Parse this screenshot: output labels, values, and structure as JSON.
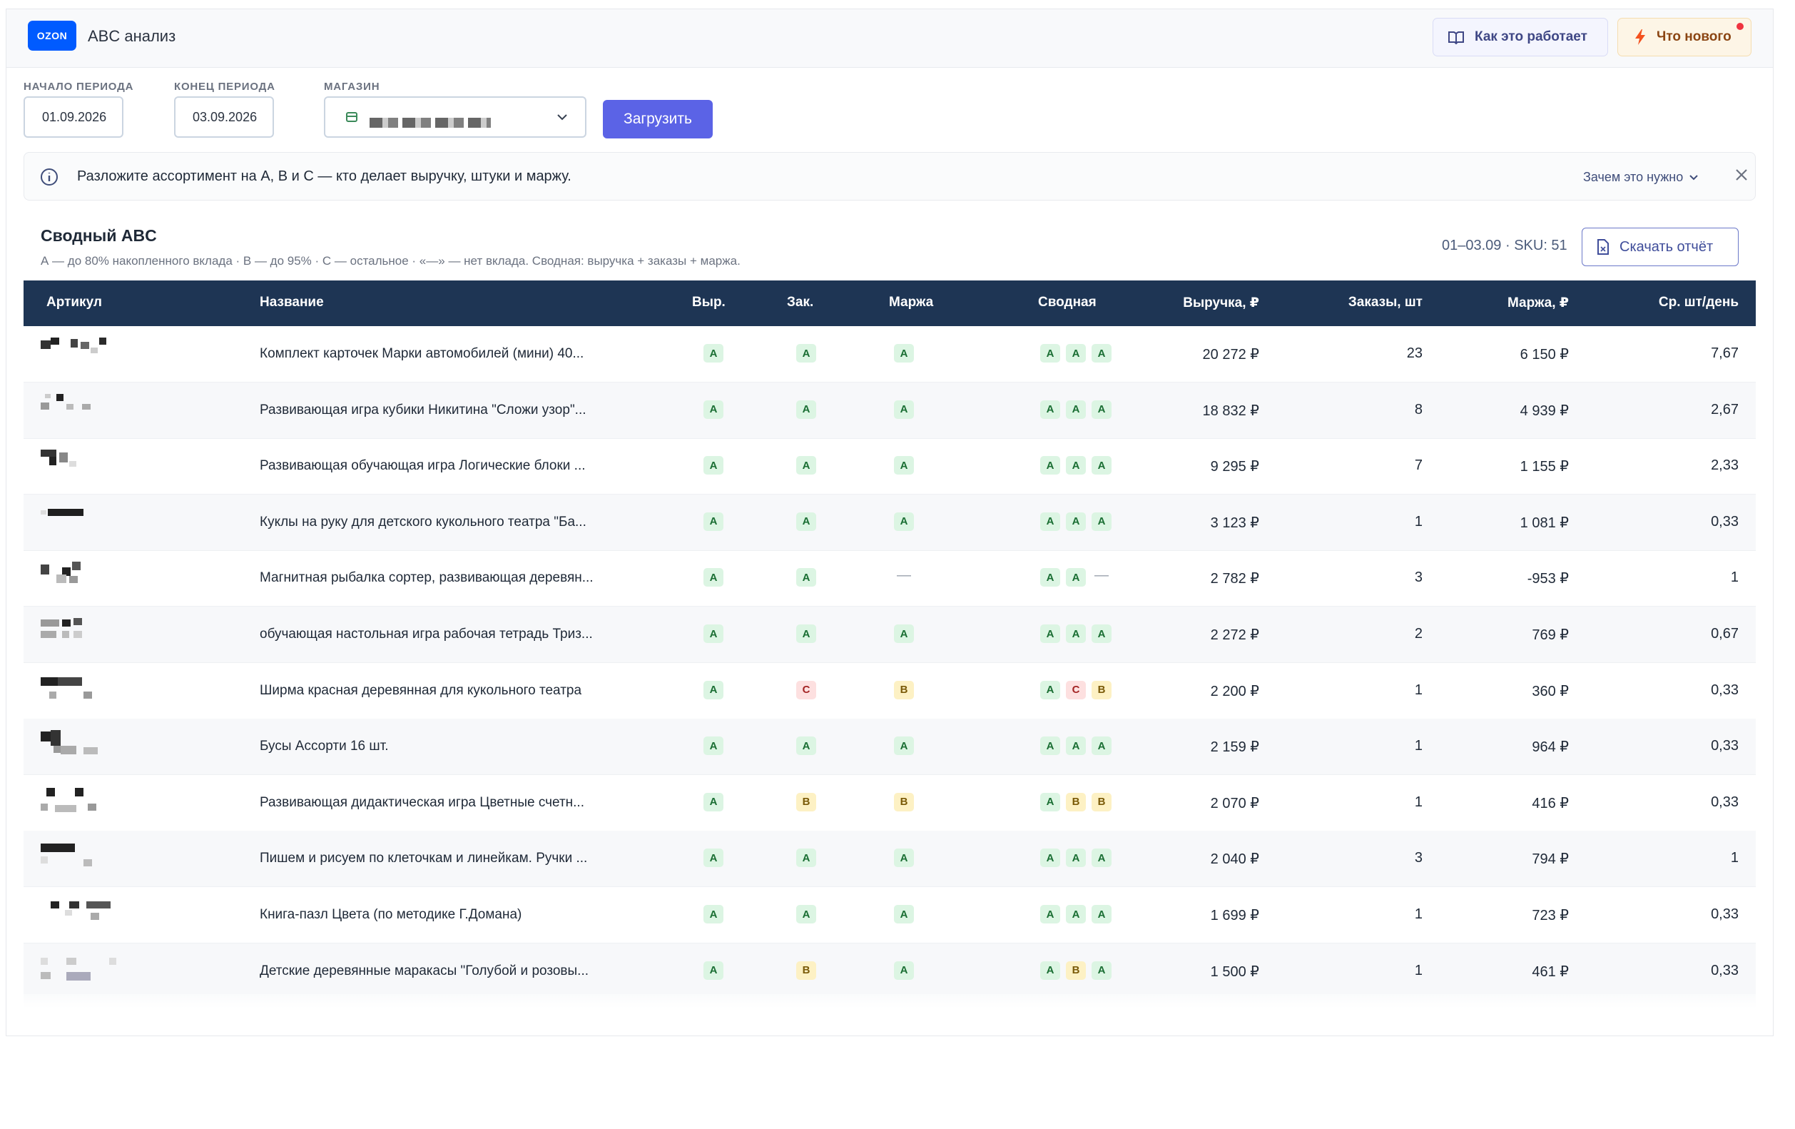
{
  "app": {
    "logo": "OZON",
    "title": "ABC анализ",
    "how_label": "Как это работает",
    "new_label": "Что нового"
  },
  "filters": {
    "start_label": "НАЧАЛО ПЕРИОДА",
    "start_value": "01.09.2026",
    "end_label": "КОНЕЦ ПЕРИОДА",
    "end_value": "03.09.2026",
    "store_label": "МАГАЗИН",
    "load_label": "Загрузить"
  },
  "info": {
    "text": "Разложите ассортимент на А, В и С — кто делает выручку, штуки и маржу.",
    "why_label": "Зачем это нужно"
  },
  "section": {
    "title": "Сводный ABC",
    "subtitle": "А — до 80% накопленного вклада · В — до 95% · С — остальное · «—» — нет вклада. Сводная: выручка + заказы + маржа.",
    "period": "01–03.09 · SKU: 51",
    "download_label": "Скачать отчёт"
  },
  "table": {
    "headers": {
      "article": "Артикул",
      "name": "Название",
      "rev": "Выр.",
      "ord": "Зак.",
      "margin": "Маржа",
      "summary": "Сводная",
      "revenue": "Выручка, ₽",
      "orders": "Заказы, шт",
      "margin_rub": "Маржа, ₽",
      "avg": "Ср. шт/день"
    },
    "rows": [
      {
        "name": "Комплект карточек Марки автомобилей (мини) 40...",
        "rev": "A",
        "ord": "A",
        "margin": "A",
        "summary": [
          "A",
          "A",
          "A"
        ],
        "revenue": "20 272 ₽",
        "orders": "23",
        "margin_rub": "6 150 ₽",
        "avg": "7,67"
      },
      {
        "name": "Развивающая игра кубики Никитина \"Сложи узор\"...",
        "rev": "A",
        "ord": "A",
        "margin": "A",
        "summary": [
          "A",
          "A",
          "A"
        ],
        "revenue": "18 832 ₽",
        "orders": "8",
        "margin_rub": "4 939 ₽",
        "avg": "2,67"
      },
      {
        "name": "Развивающая обучающая игра Логические блоки ...",
        "rev": "A",
        "ord": "A",
        "margin": "A",
        "summary": [
          "A",
          "A",
          "A"
        ],
        "revenue": "9 295 ₽",
        "orders": "7",
        "margin_rub": "1 155 ₽",
        "avg": "2,33"
      },
      {
        "name": "Куклы на руку для детского кукольного театра \"Ба...",
        "rev": "A",
        "ord": "A",
        "margin": "A",
        "summary": [
          "A",
          "A",
          "A"
        ],
        "revenue": "3 123 ₽",
        "orders": "1",
        "margin_rub": "1 081 ₽",
        "avg": "0,33"
      },
      {
        "name": "Магнитная рыбалка сортер, развивающая деревян...",
        "rev": "A",
        "ord": "A",
        "margin": "—",
        "summary": [
          "A",
          "A",
          "—"
        ],
        "revenue": "2 782 ₽",
        "orders": "3",
        "margin_rub": "-953 ₽",
        "avg": "1"
      },
      {
        "name": "обучающая настольная игра рабочая тетрадь Триз...",
        "rev": "A",
        "ord": "A",
        "margin": "A",
        "summary": [
          "A",
          "A",
          "A"
        ],
        "revenue": "2 272 ₽",
        "orders": "2",
        "margin_rub": "769 ₽",
        "avg": "0,67"
      },
      {
        "name": "Ширма красная деревянная для кукольного театра",
        "rev": "A",
        "ord": "C",
        "margin": "B",
        "summary": [
          "A",
          "C",
          "B"
        ],
        "revenue": "2 200 ₽",
        "orders": "1",
        "margin_rub": "360 ₽",
        "avg": "0,33"
      },
      {
        "name": "Бусы Ассорти 16 шт.",
        "rev": "A",
        "ord": "A",
        "margin": "A",
        "summary": [
          "A",
          "A",
          "A"
        ],
        "revenue": "2 159 ₽",
        "orders": "1",
        "margin_rub": "964 ₽",
        "avg": "0,33"
      },
      {
        "name": "Развивающая дидактическая игра Цветные счетн...",
        "rev": "A",
        "ord": "B",
        "margin": "B",
        "summary": [
          "A",
          "B",
          "B"
        ],
        "revenue": "2 070 ₽",
        "orders": "1",
        "margin_rub": "416 ₽",
        "avg": "0,33"
      },
      {
        "name": "Пишем и рисуем по клеточкам и линейкам. Ручки ...",
        "rev": "A",
        "ord": "A",
        "margin": "A",
        "summary": [
          "A",
          "A",
          "A"
        ],
        "revenue": "2 040 ₽",
        "orders": "3",
        "margin_rub": "794 ₽",
        "avg": "1"
      },
      {
        "name": "Книга-пазл Цвета (по методике Г.Домана)",
        "rev": "A",
        "ord": "A",
        "margin": "A",
        "summary": [
          "A",
          "A",
          "A"
        ],
        "revenue": "1 699 ₽",
        "orders": "1",
        "margin_rub": "723 ₽",
        "avg": "0,33"
      },
      {
        "name": "Детские деревянные маракасы \"Голубой и розовы...",
        "rev": "A",
        "ord": "B",
        "margin": "A",
        "summary": [
          "A",
          "B",
          "A"
        ],
        "revenue": "1 500 ₽",
        "orders": "1",
        "margin_rub": "461 ₽",
        "avg": "0,33"
      }
    ]
  },
  "colors": {
    "accent": "#5b63e6",
    "header_bg": "#1e3554",
    "class_a": "#dcf5e3",
    "class_b": "#fdf1c4",
    "class_c": "#fde0e0"
  },
  "icons": {
    "how": "book-icon",
    "new": "lightning-icon",
    "info": "info-icon",
    "download": "file-icon",
    "close": "close-icon",
    "store": "store-icon",
    "chevron": "chevron-down-icon"
  }
}
